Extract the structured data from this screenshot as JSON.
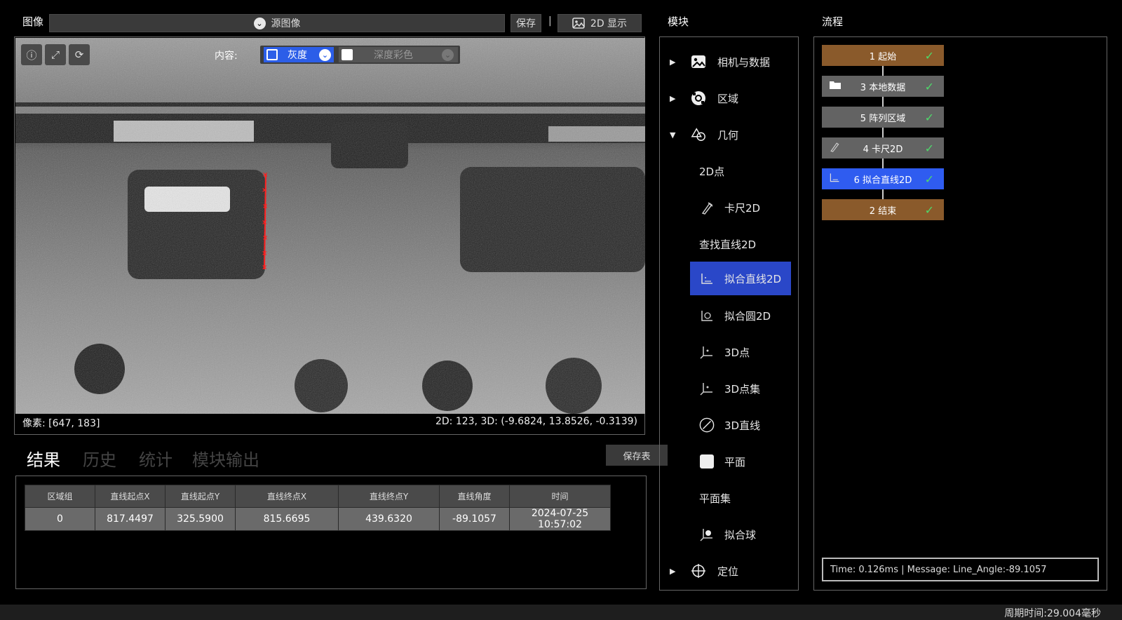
{
  "header": {
    "image_label": "图像",
    "source_value": "源图像",
    "save_label": "保存",
    "separator": "|",
    "display_label": "2D 显示"
  },
  "viewer": {
    "content_label": "内容:",
    "gray_label": "灰度",
    "depth_label": "深度彩色",
    "pixel_readout": "像素: [647, 183]",
    "coord_readout": "2D: 123, 3D: (-9.6824, 13.8526, -0.3139)"
  },
  "results": {
    "tabs": [
      "结果",
      "历史",
      "统计",
      "模块输出"
    ],
    "save_table_label": "保存表",
    "columns": [
      "区域组",
      "直线起点X",
      "直线起点Y",
      "直线终点X",
      "直线终点Y",
      "直线角度",
      "时间"
    ],
    "rows": [
      [
        "0",
        "817.4497",
        "325.5900",
        "815.6695",
        "439.6320",
        "-89.1057",
        "2024-07-25 10:57:02"
      ]
    ]
  },
  "modules": {
    "title": "模块",
    "items": [
      {
        "label": "相机与数据",
        "icon": "image-icon",
        "arrow": "▶"
      },
      {
        "label": "区域",
        "icon": "region-icon",
        "arrow": "▶"
      },
      {
        "label": "几何",
        "icon": "shapes-icon",
        "arrow": "▼"
      },
      {
        "label": "2D点"
      },
      {
        "label": "卡尺2D",
        "icon": "caliper-icon"
      },
      {
        "label": "查找直线2D"
      },
      {
        "label": "拟合直线2D",
        "icon": "fit-line-icon"
      },
      {
        "label": "拟合圆2D",
        "icon": "fit-circle-icon"
      },
      {
        "label": "3D点",
        "icon": "point-3d-icon"
      },
      {
        "label": "3D点集",
        "icon": "point-set-3d-icon"
      },
      {
        "label": "3D直线",
        "icon": "line-3d-icon"
      },
      {
        "label": "平面",
        "icon": "plane-icon"
      },
      {
        "label": "平面集"
      },
      {
        "label": "拟合球",
        "icon": "fit-sphere-icon"
      },
      {
        "label": "定位",
        "icon": "locate-icon",
        "arrow": "▶"
      }
    ]
  },
  "flow": {
    "title": "流程",
    "nodes": [
      {
        "label": "1 起始",
        "color": "#8a5a2b",
        "check": "✓"
      },
      {
        "label": "3 本地数据",
        "color": "#636363",
        "check": "✓"
      },
      {
        "label": "5 阵列区域",
        "color": "#636363",
        "check": "✓"
      },
      {
        "label": "4 卡尺2D",
        "color": "#636363",
        "check": "✓"
      },
      {
        "label": "6 拟合直线2D",
        "color": "#2f5cf0",
        "check": "✓"
      },
      {
        "label": "2 结束",
        "color": "#8a5a2b",
        "check": "✓"
      }
    ],
    "message": "Time: 0.126ms  |   Message: Line_Angle:-89.1057"
  },
  "status": {
    "cycle_time": "周期时间:29.004毫秒"
  }
}
